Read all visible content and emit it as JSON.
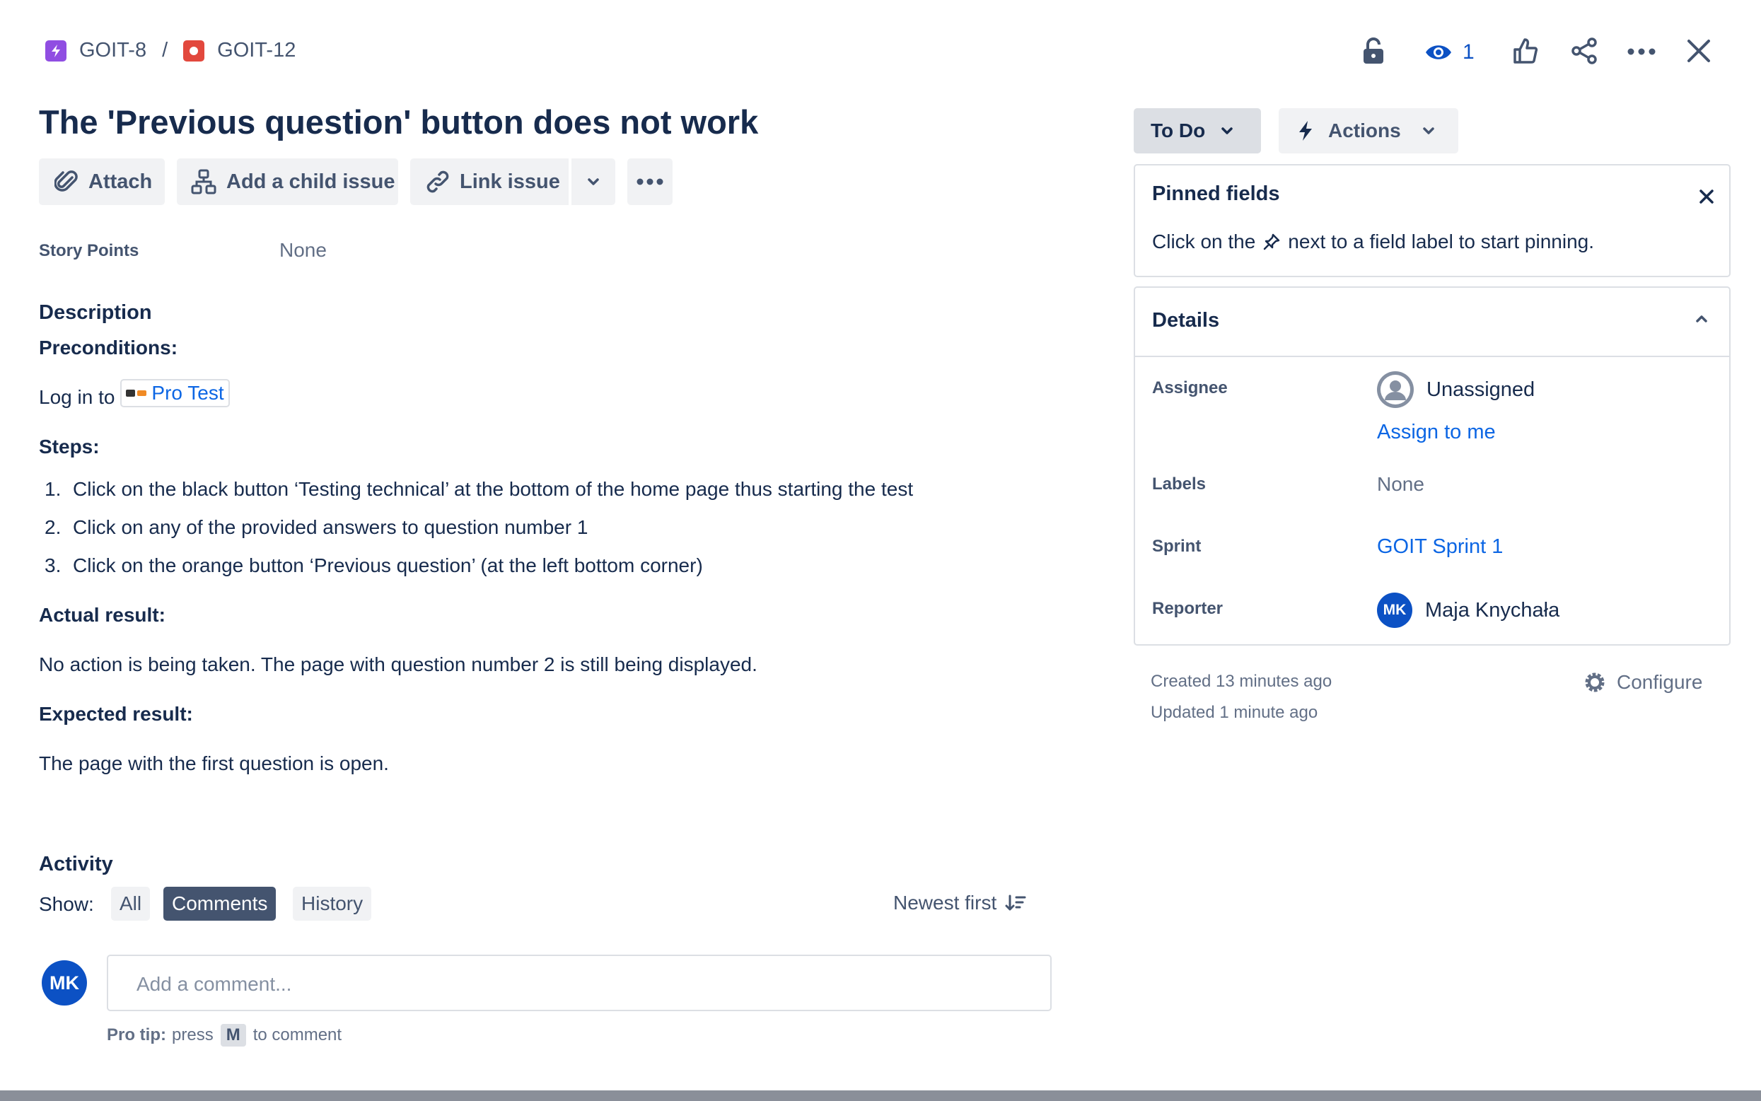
{
  "breadcrumb": {
    "parent": "GOIT-8",
    "separator": "/",
    "current": "GOIT-12",
    "parent_icon": "epic-lightning-icon",
    "current_icon": "bug-icon",
    "parent_color": "#904ee2",
    "current_color": "#e2483d"
  },
  "header_actions": {
    "watch_count": "1"
  },
  "issue": {
    "title": "The 'Previous question' button does not work"
  },
  "toolbar": {
    "attach": "Attach",
    "add_child": "Add a child issue",
    "link_issue": "Link issue"
  },
  "fields": {
    "story_points_label": "Story Points",
    "story_points_value": "None"
  },
  "description": {
    "heading": "Description",
    "preconditions_heading": "Preconditions:",
    "login_prefix": "Log in to",
    "login_link": "Pro Test",
    "steps_heading": "Steps:",
    "steps": [
      {
        "num": "1.",
        "text": "Click on the black button ‘Testing technical’ at the bottom of the home page thus starting the test"
      },
      {
        "num": "2.",
        "text": "Click on any of the provided answers to question number 1"
      },
      {
        "num": "3.",
        "text": "Click on the orange button ‘Previous question’ (at the left bottom corner)"
      }
    ],
    "actual_heading": "Actual result:",
    "actual_text": "No action is being taken. The page with question number 2 is still being displayed.",
    "expected_heading": "Expected result:",
    "expected_text": "The page with the first question is open."
  },
  "activity": {
    "heading": "Activity",
    "show_label": "Show:",
    "filters": [
      "All",
      "Comments",
      "History"
    ],
    "active_filter": "Comments",
    "sort_label": "Newest first",
    "comment_placeholder": "Add a comment...",
    "avatar_initials": "MK",
    "pro_tip_label": "Pro tip:",
    "pro_tip_press": "press",
    "pro_tip_key": "M",
    "pro_tip_suffix": "to comment"
  },
  "status": {
    "label": "To Do",
    "actions_label": "Actions"
  },
  "pinned": {
    "title": "Pinned fields",
    "hint_before": "Click on the",
    "hint_after": "next to a field label to start pinning."
  },
  "details": {
    "title": "Details",
    "assignee_label": "Assignee",
    "assignee_value": "Unassigned",
    "assign_to_me": "Assign to me",
    "labels_label": "Labels",
    "labels_value": "None",
    "sprint_label": "Sprint",
    "sprint_value": "GOIT Sprint 1",
    "reporter_label": "Reporter",
    "reporter_initials": "MK",
    "reporter_value": "Maja Knychała"
  },
  "meta": {
    "created": "Created 13 minutes ago",
    "updated": "Updated 1 minute ago",
    "configure": "Configure"
  },
  "colors": {
    "accent": "#0c66e4",
    "active_chip": "#44546f",
    "avatar": "#0c51c4"
  }
}
